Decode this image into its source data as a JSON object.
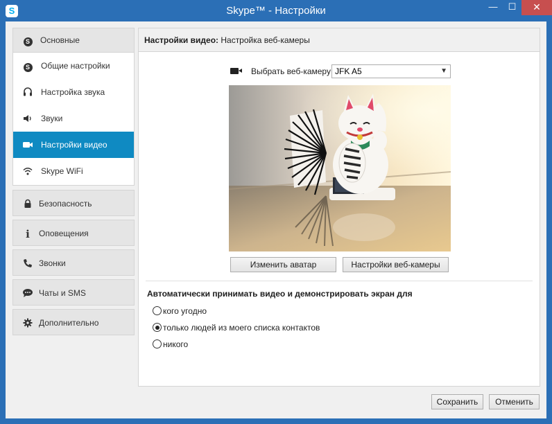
{
  "window": {
    "title": "Skype™ - Настройки",
    "app_icon_letter": "S",
    "minimize_glyph": "—",
    "maximize_glyph": "☐",
    "close_glyph": "✕"
  },
  "sidebar": {
    "general_group": {
      "header": {
        "label": "Основные",
        "icon": "skype-icon"
      },
      "items": [
        {
          "label": "Общие настройки",
          "icon": "skype-icon"
        },
        {
          "label": "Настройка звука",
          "icon": "headset-icon"
        },
        {
          "label": "Звуки",
          "icon": "speaker-icon"
        },
        {
          "label": "Настройки видео",
          "icon": "video-camera-icon",
          "active": true
        },
        {
          "label": "Skype WiFi",
          "icon": "wifi-icon"
        }
      ]
    },
    "groups": [
      {
        "label": "Безопасность",
        "icon": "lock-icon"
      },
      {
        "label": "Оповещения",
        "icon": "info-icon"
      },
      {
        "label": "Звонки",
        "icon": "phone-icon"
      },
      {
        "label": "Чаты и SMS",
        "icon": "chat-icon"
      },
      {
        "label": "Дополнительно",
        "icon": "gear-icon"
      }
    ]
  },
  "panel": {
    "header_bold": "Настройки видео:",
    "header_rest": " Настройка веб-камеры",
    "camera_label": "Выбрать веб-камеру:",
    "camera_selected": "JFK A5",
    "change_avatar_button": "Изменить аватар",
    "webcam_settings_button": "Настройки веб-камеры",
    "auto_accept_title": "Автоматически принимать видео и демонстрировать экран для",
    "options": [
      {
        "label": "кого угодно",
        "checked": false
      },
      {
        "label": "только людей из моего списка контактов",
        "checked": true
      },
      {
        "label": "никого",
        "checked": false
      }
    ]
  },
  "footer": {
    "save_button": "Сохранить",
    "cancel_button": "Отменить"
  }
}
